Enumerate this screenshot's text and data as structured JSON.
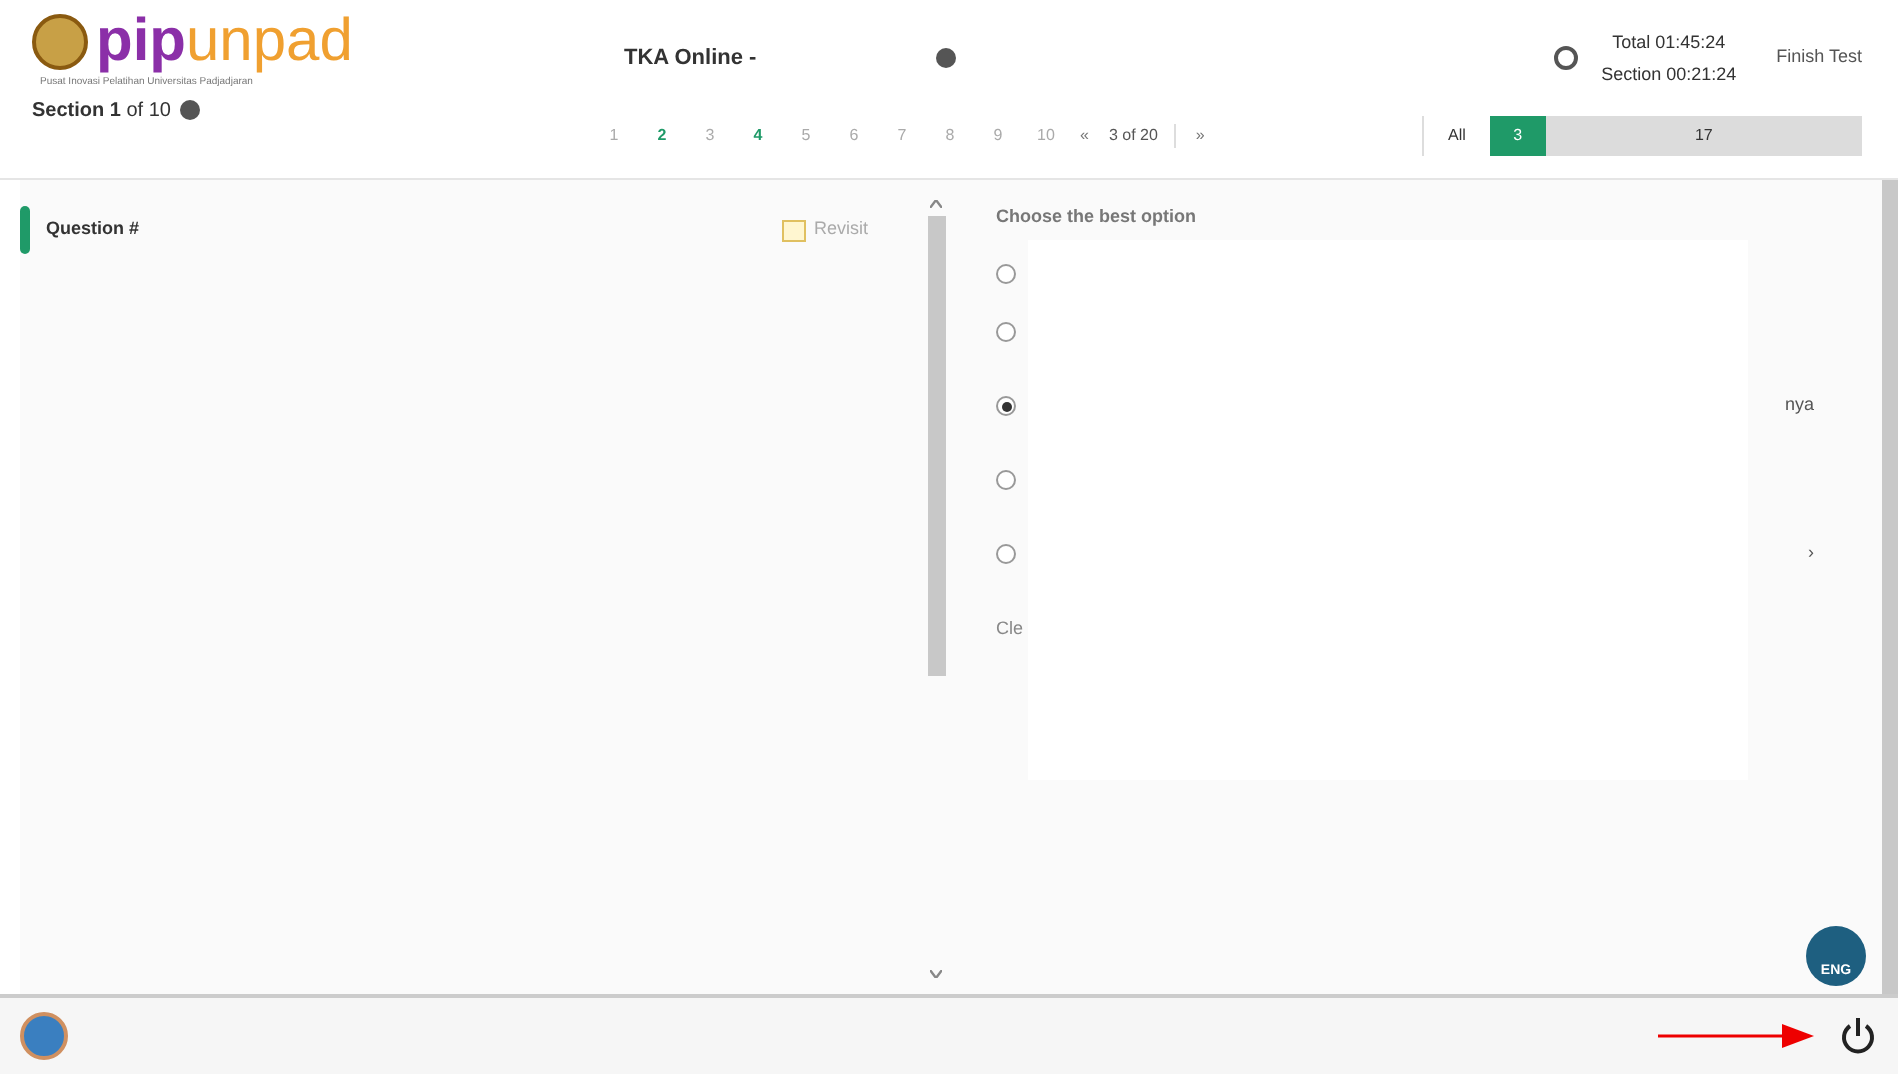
{
  "logo": {
    "text_a": "pip",
    "text_b": "unpad",
    "subtitle": "Pusat Inovasi Pelatihan Universitas Padjadjaran"
  },
  "section": {
    "prefix": "Section",
    "number": "1",
    "suffix": "of 10"
  },
  "test_title": "TKA Online -",
  "timer": {
    "total": "Total 01:45:24",
    "section": "Section 00:21:24"
  },
  "finish_button": "Finish Test",
  "pages": [
    {
      "label": "1",
      "answered": false
    },
    {
      "label": "2",
      "answered": true
    },
    {
      "label": "3",
      "answered": false
    },
    {
      "label": "4",
      "answered": true
    },
    {
      "label": "5",
      "answered": false
    },
    {
      "label": "6",
      "answered": false
    },
    {
      "label": "7",
      "answered": false
    },
    {
      "label": "8",
      "answered": false
    },
    {
      "label": "9",
      "answered": false
    },
    {
      "label": "10",
      "answered": false
    }
  ],
  "page_prev": "«",
  "page_position": "3 of 20",
  "page_next": "»",
  "summary": {
    "all_label": "All",
    "answered": "3",
    "unanswered": "17",
    "level": 0.15
  },
  "question": {
    "title": "Question #",
    "revisit": "Revisit"
  },
  "prompt": "Choose the best option",
  "options": [
    {
      "selected": false
    },
    {
      "selected": false
    },
    {
      "text": "nya",
      "selected": true
    },
    {
      "selected": false
    },
    {
      "text": "›",
      "selected": false
    }
  ],
  "clear_button": "Cle",
  "language": "ENG"
}
